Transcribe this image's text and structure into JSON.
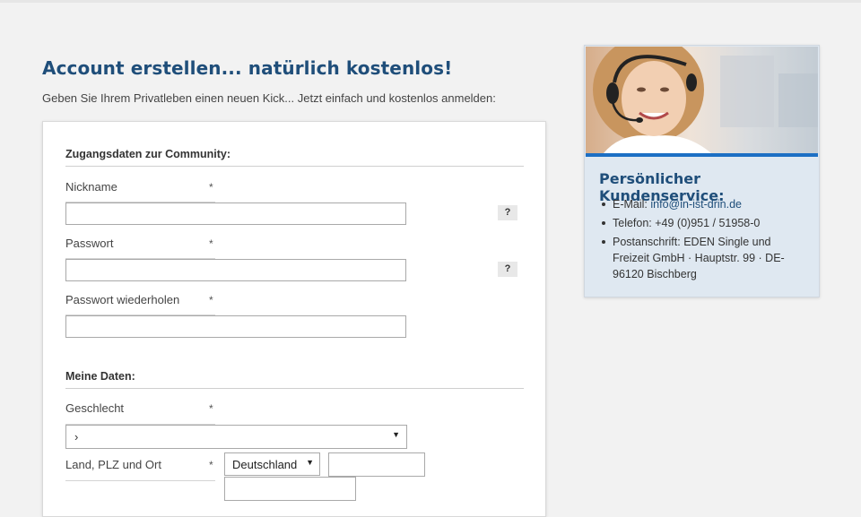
{
  "header": {
    "title": "Account erstellen... natürlich kostenlos!",
    "subtitle": "Geben Sie Ihrem Privatleben einen neuen Kick... Jetzt einfach und kostenlos anmelden:"
  },
  "form": {
    "section_access": "Zugangsdaten zur Community:",
    "section_personal": "Meine Daten:",
    "required_marker": "*",
    "help_label": "?",
    "fields": {
      "nickname": {
        "label": "Nickname",
        "value": ""
      },
      "password": {
        "label": "Passwort",
        "value": ""
      },
      "password_repeat": {
        "label": "Passwort wiederholen",
        "value": ""
      },
      "gender": {
        "label": "Geschlecht",
        "selected": "›"
      },
      "location": {
        "label": "Land, PLZ und Ort",
        "country_selected": "Deutschland",
        "plz": "",
        "city": ""
      }
    },
    "select_arrow": "▼"
  },
  "sidebar": {
    "title": "Persönlicher Kundenservice:",
    "email_label": "E-Mail: ",
    "email": "info@in-ist-drin.de",
    "phone": "Telefon: +49 (0)951 / 51958-0",
    "address": "Postanschrift: EDEN Single und Freizeit GmbH · Hauptstr. 99 · DE-96120 Bischberg"
  },
  "colors": {
    "accent": "#1f4e7a",
    "bar": "#1c6fc4",
    "sidebar_bg": "#dfe8f1"
  }
}
